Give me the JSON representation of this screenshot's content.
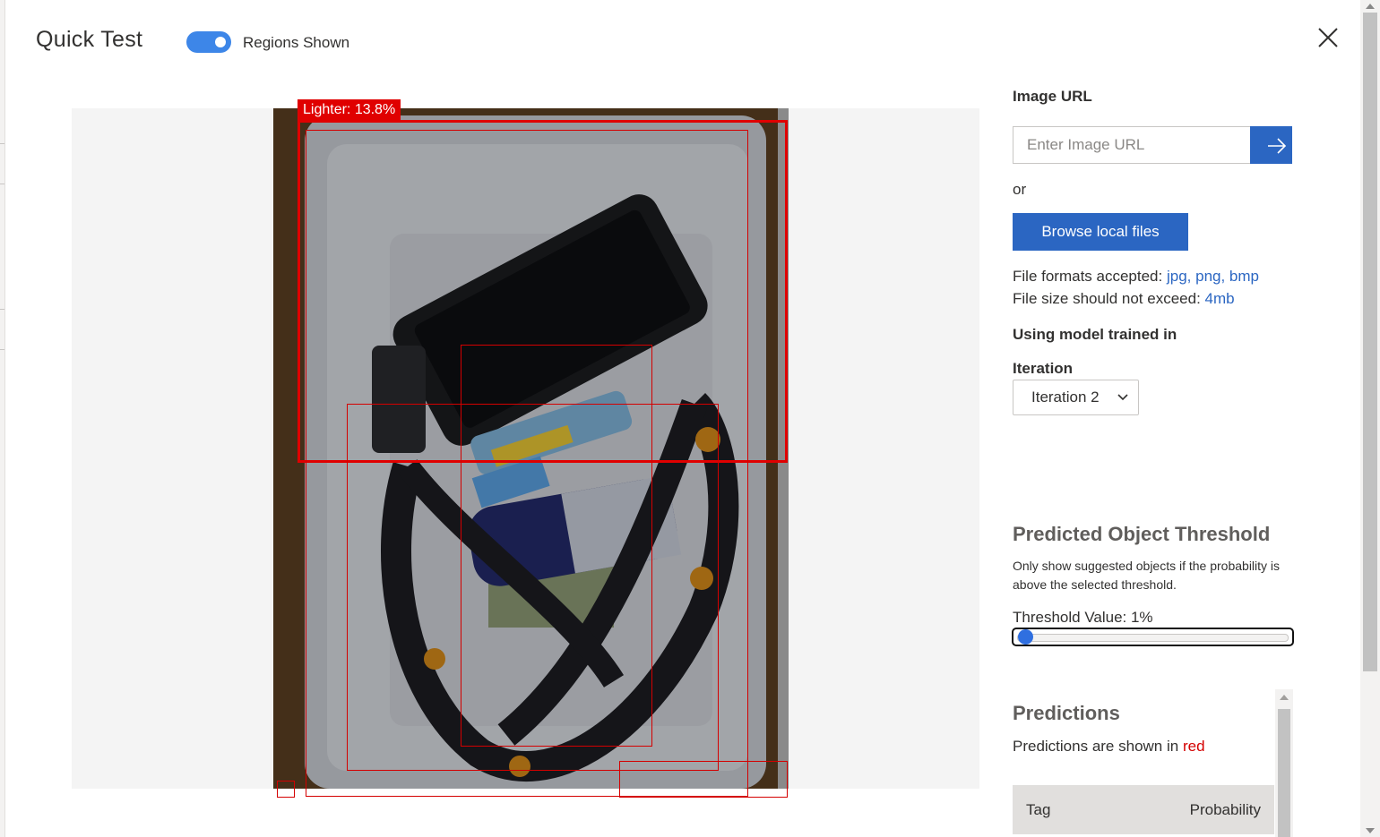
{
  "header": {
    "title": "Quick Test",
    "toggle_label": "Regions Shown",
    "toggle_on": true,
    "close_icon": "close-icon"
  },
  "preview": {
    "region_label": "Lighter: 13.8%"
  },
  "image_url": {
    "label": "Image URL",
    "placeholder": "Enter Image URL",
    "submit_icon": "arrow-right-icon"
  },
  "or_text": "or",
  "browse_label": "Browse local files",
  "file_info": {
    "formats_label": "File formats accepted:",
    "formats_value": "jpg, png, bmp",
    "size_label": "File size should not exceed:",
    "size_value": "4mb"
  },
  "model": {
    "label": "Using model trained in",
    "iteration_label": "Iteration",
    "iteration_value": "Iteration 2"
  },
  "threshold": {
    "title": "Predicted Object Threshold",
    "description": "Only show suggested objects if the probability is above the selected threshold.",
    "value_label": "Threshold Value: 1%",
    "value_fraction": 0.01
  },
  "predictions": {
    "title": "Predictions",
    "note_prefix": "Predictions are shown in",
    "note_color_word": "red",
    "columns": [
      "Tag",
      "Probability"
    ]
  },
  "colors": {
    "accent": "#2b66c2",
    "toggle": "#3d86e8",
    "region": "#e00000"
  }
}
